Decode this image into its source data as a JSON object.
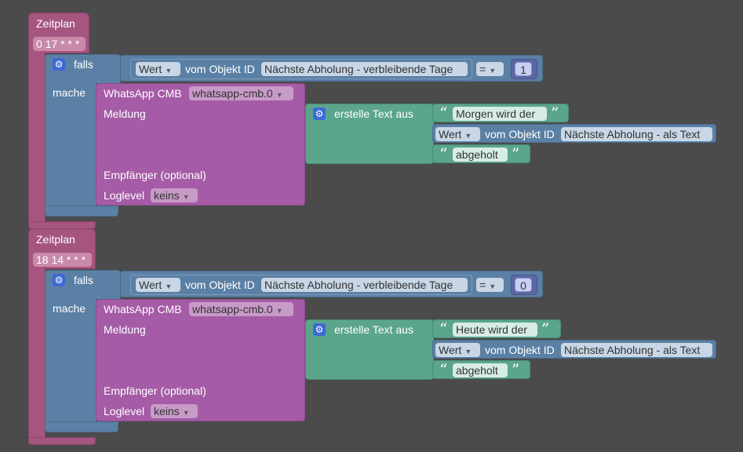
{
  "blocks": [
    {
      "schedule_label": "Zeitplan",
      "cron": "0 17 * * *",
      "if_label": "falls",
      "do_label": "mache",
      "condition": {
        "source": "Wert",
        "of_object_label": "vom Objekt ID",
        "object": "Nächste Abholung - verbleibende Tage",
        "operator": "=",
        "value": "1"
      },
      "whatsapp": {
        "title": "WhatsApp CMB",
        "instance": "whatsapp-cmb.0",
        "message_label": "Meldung",
        "recipient_label": "Empfänger (optional)",
        "loglevel_label": "Loglevel",
        "loglevel": "keins"
      },
      "text_join": {
        "label": "erstelle Text aus",
        "part1": "Morgen wird der",
        "part2_source": "Wert",
        "part2_of_object_label": "vom Objekt ID",
        "part2_object": "Nächste Abholung - als Text",
        "part3": "abgeholt"
      }
    },
    {
      "schedule_label": "Zeitplan",
      "cron": "18 14 * * *",
      "if_label": "falls",
      "do_label": "mache",
      "condition": {
        "source": "Wert",
        "of_object_label": "vom Objekt ID",
        "object": "Nächste Abholung - verbleibende Tage",
        "operator": "=",
        "value": "0"
      },
      "whatsapp": {
        "title": "WhatsApp CMB",
        "instance": "whatsapp-cmb.0",
        "message_label": "Meldung",
        "recipient_label": "Empfänger (optional)",
        "loglevel_label": "Loglevel",
        "loglevel": "keins"
      },
      "text_join": {
        "label": "erstelle Text aus",
        "part1": "Heute wird der",
        "part2_source": "Wert",
        "part2_of_object_label": "vom Objekt ID",
        "part2_object": "Nächste Abholung - als Text",
        "part3": "abgeholt"
      }
    }
  ],
  "icons": {
    "gear": "gear-icon",
    "dropdown": "chevron-down-icon",
    "quote_open": "quote-open-icon",
    "quote_close": "quote-close-icon"
  }
}
